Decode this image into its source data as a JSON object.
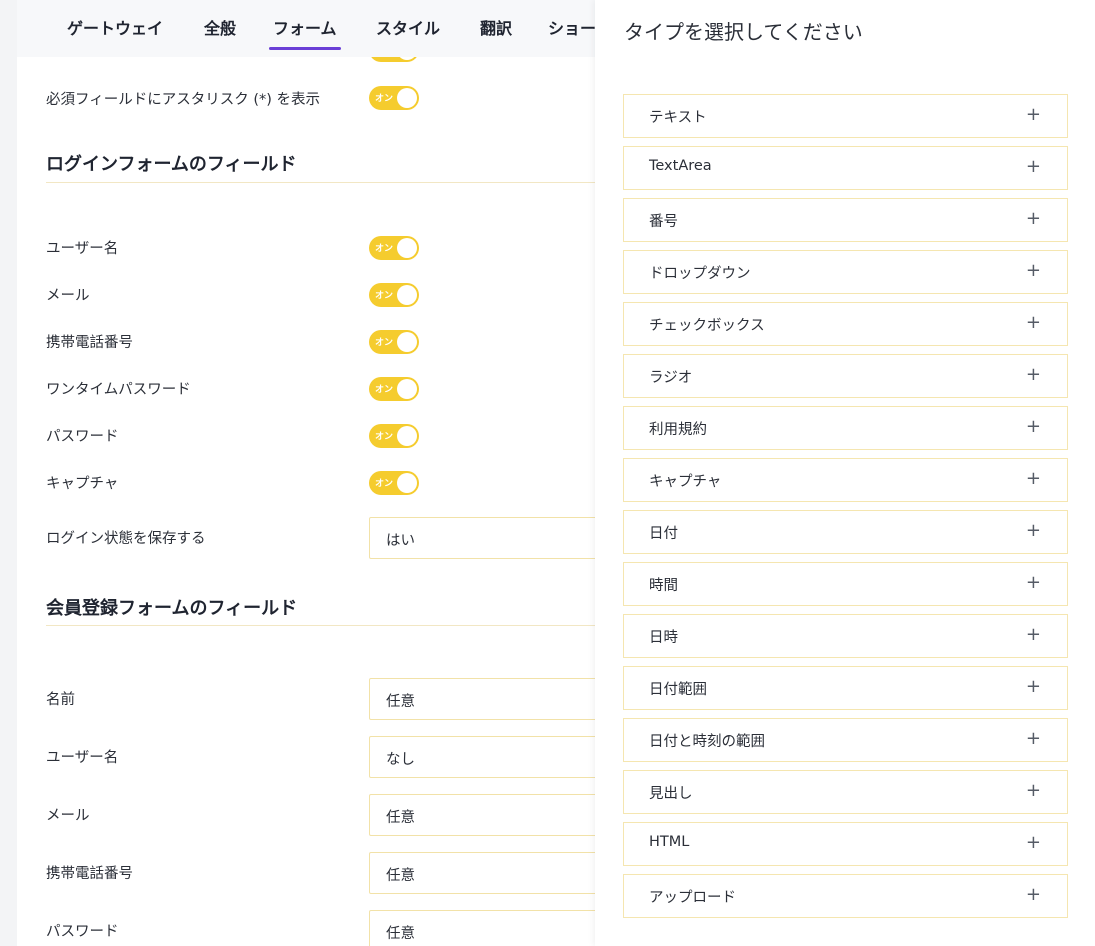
{
  "tabs": [
    "ゲートウェイ",
    "全般",
    "フォーム",
    "スタイル",
    "翻訳",
    "ショー"
  ],
  "active_tab": "フォーム",
  "top_partial_label": "必須フィールドにアスタリスク (*) を表示",
  "toggle_text": "オン",
  "login_section": {
    "title": "ログインフォームのフィールド",
    "toggles": [
      "ユーザー名",
      "メール",
      "携帯電話番号",
      "ワンタイムパスワード",
      "パスワード",
      "キャプチャ"
    ],
    "remember_label": "ログイン状態を保存する",
    "remember_value": "はい"
  },
  "register_section": {
    "title": "会員登録フォームのフィールド",
    "fields": [
      {
        "label": "名前",
        "value": "任意"
      },
      {
        "label": "ユーザー名",
        "value": "なし"
      },
      {
        "label": "メール",
        "value": "任意"
      },
      {
        "label": "携帯電話番号",
        "value": "任意"
      },
      {
        "label": "パスワード",
        "value": "任意"
      }
    ]
  },
  "type_panel": {
    "title": "タイプを選択してください",
    "plus_symbol": "+",
    "types": [
      "テキスト",
      "TextArea",
      "番号",
      "ドロップダウン",
      "チェックボックス",
      "ラジオ",
      "利用規約",
      "キャプチャ",
      "日付",
      "時間",
      "日時",
      "日付範囲",
      "日付と時刻の範囲",
      "見出し",
      "HTML",
      "アップロード"
    ]
  },
  "colors": {
    "accent": "#6a3fd6",
    "toggle_on": "#f5cc2e",
    "border": "#f5e6b0"
  }
}
